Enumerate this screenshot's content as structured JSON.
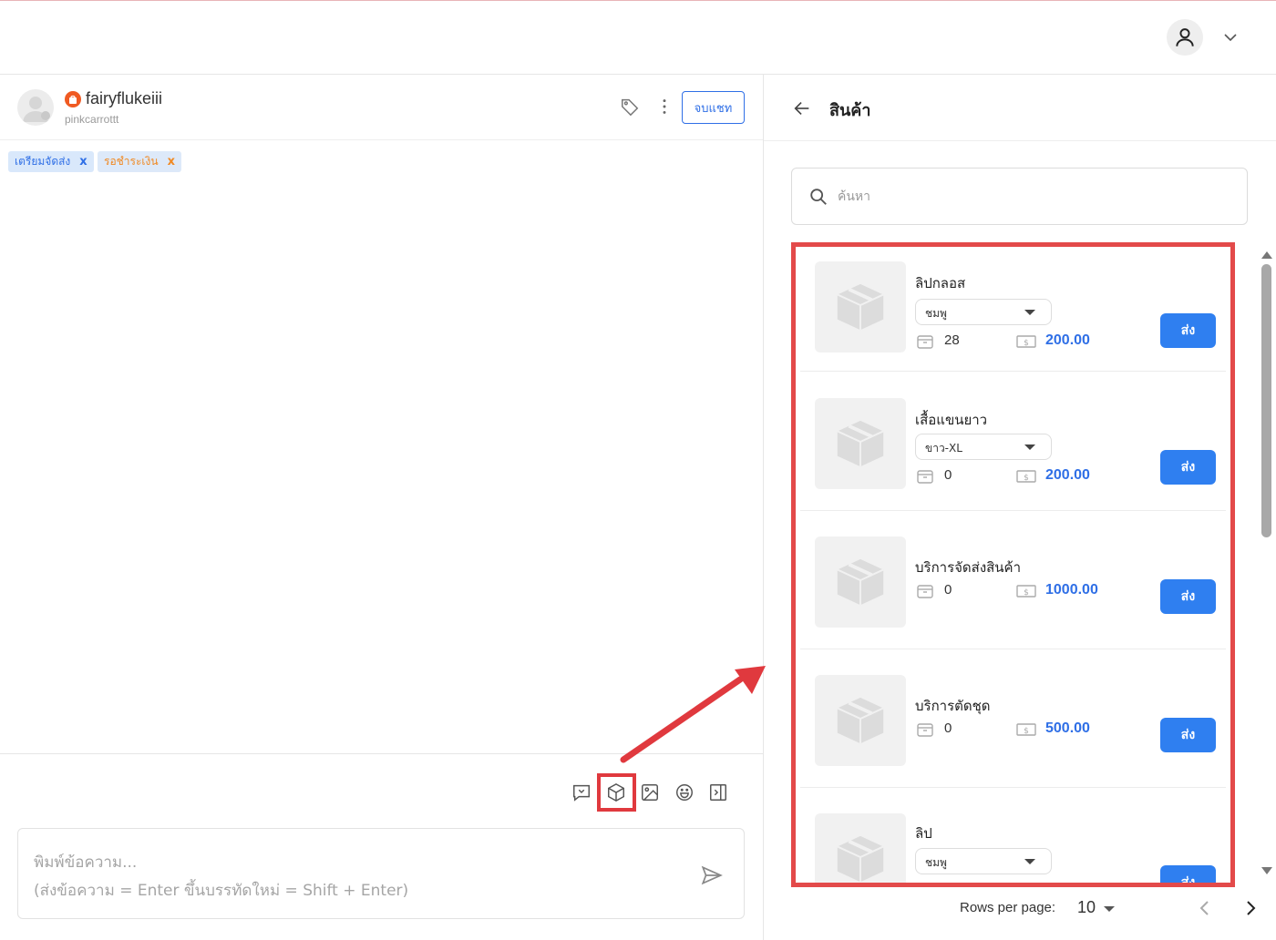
{
  "header": {
    "account_icon": "user-icon",
    "menu_icon": "chevron-down-icon"
  },
  "chat": {
    "username": "fairyflukeiii",
    "handle": "pinkcarrottt",
    "end_chat_label": "จบแชท",
    "tags": [
      {
        "label": "เตรียมจัดส่ง",
        "remove": "x",
        "color": "#2f6fe6"
      },
      {
        "label": "รอชำระเงิน",
        "remove": "x",
        "color": "#f08a24"
      }
    ],
    "composer": {
      "placeholder_line1": "พิมพ์ข้อความ...",
      "placeholder_line2": "(ส่งข้อความ = Enter ขึ้นบรรทัดใหม่ = Shift + Enter)"
    }
  },
  "products_panel": {
    "title": "สินค้า",
    "search_placeholder": "ค้นหา",
    "send_label": "ส่ง",
    "items": [
      {
        "name": "ลิปกลอส",
        "variant": "ชมพู",
        "stock": "28",
        "price": "200.00"
      },
      {
        "name": "เสื้อแขนยาว",
        "variant": "ขาว-XL",
        "stock": "0",
        "price": "200.00"
      },
      {
        "name": "บริการจัดส่งสินค้า",
        "stock": "0",
        "price": "1000.00"
      },
      {
        "name": "บริการตัดชุด",
        "stock": "0",
        "price": "500.00"
      },
      {
        "name": "ลิป",
        "variant": "ชมพู"
      }
    ],
    "pagination": {
      "rows_per_page_label": "Rows per page:",
      "rows_per_page": "10"
    }
  },
  "colors": {
    "accent": "#2f7ff0",
    "highlight": "#e0393e"
  }
}
